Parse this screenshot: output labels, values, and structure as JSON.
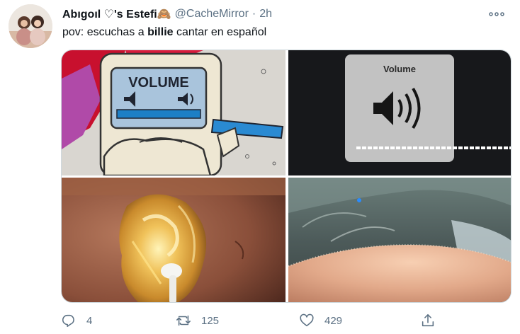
{
  "tweet": {
    "display_name": "Abıgoıl ♡'s Estefi🙈",
    "handle": "@CacheMirror",
    "separator": "·",
    "time": "2h",
    "text_before": "pov: escuchas a ",
    "text_bold": "billie",
    "text_after": " cantar en español"
  },
  "media": {
    "tile1_label": "VOLUME",
    "tile2_label": "Volume"
  },
  "actions": {
    "reply_count": "4",
    "retweet_count": "125",
    "like_count": "429"
  },
  "icons": {
    "reply": "reply-icon",
    "retweet": "retweet-icon",
    "like": "heart-icon",
    "share": "share-icon",
    "more": "more-icon"
  },
  "colors": {
    "secondary_text": "#5b7083",
    "primary_text": "#0f1419"
  }
}
